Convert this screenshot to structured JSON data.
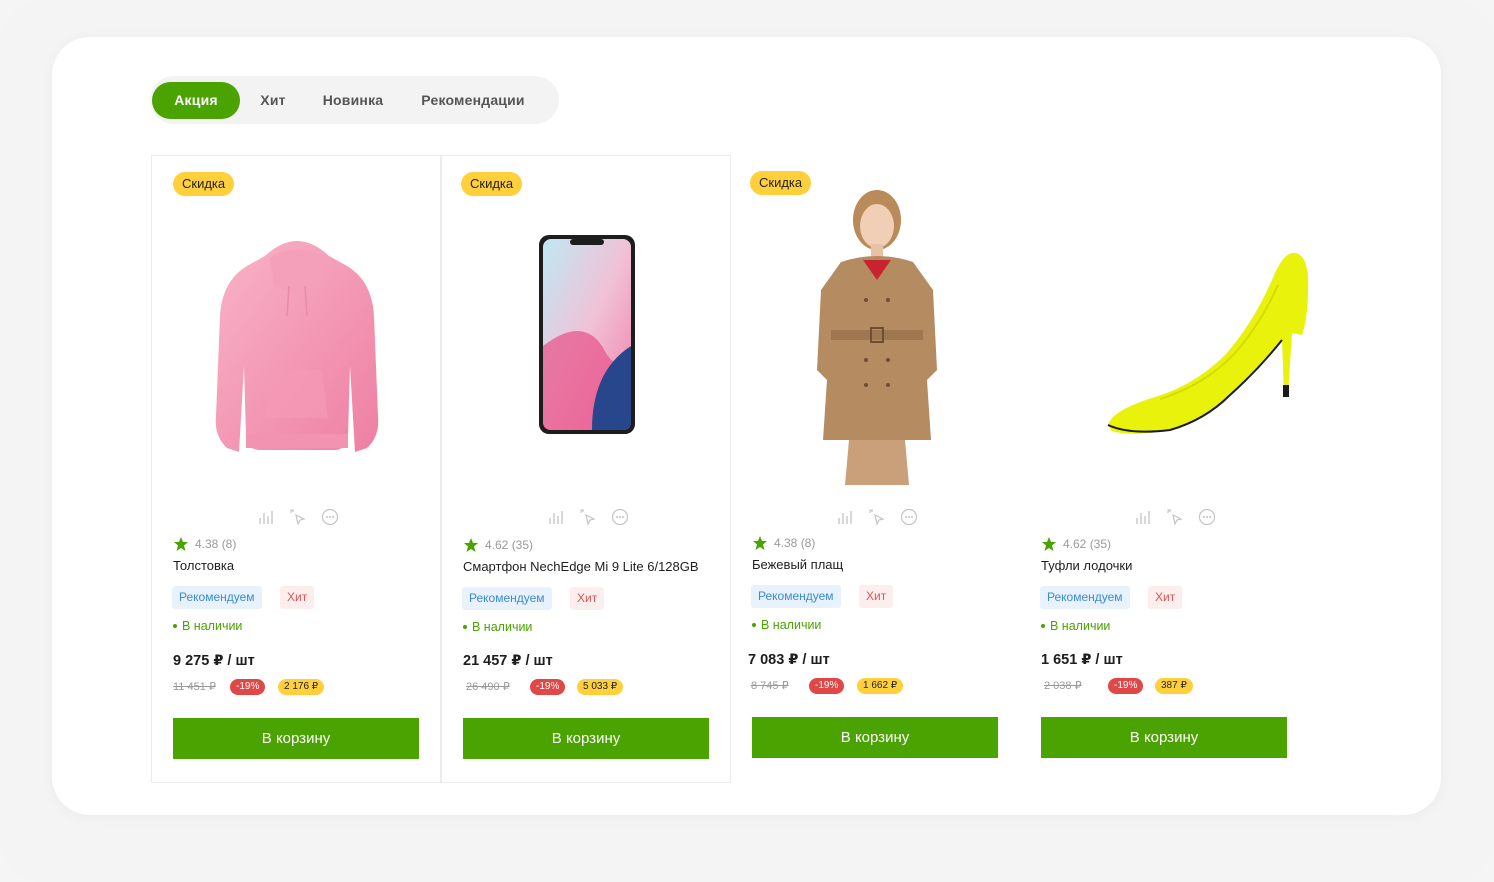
{
  "tabs": [
    {
      "label": "Акция",
      "active": true
    },
    {
      "label": "Хит",
      "active": false
    },
    {
      "label": "Новинка",
      "active": false
    },
    {
      "label": "Рекомендации",
      "active": false
    }
  ],
  "colors": {
    "accent": "#4aa300",
    "badge_yellow": "#ffcf3c",
    "discount_red": "#e04848"
  },
  "products": [
    {
      "sale_badge": "Скидка",
      "image": "pink-hoodie",
      "rating": "4.38 (8)",
      "name": "Толстовка",
      "tag_recommend": "Рекомендуем",
      "tag_hit": "Хит",
      "stock": "В наличии",
      "price": "9 275 ₽ / шт",
      "old_price": "11 451 ₽",
      "discount": "-19%",
      "saving": "2 176 ₽",
      "cart_label": "В корзину"
    },
    {
      "sale_badge": "Скидка",
      "image": "smartphone",
      "rating": "4.62 (35)",
      "name": "Смартфон NechEdge Mi 9 Lite 6/128GB",
      "tag_recommend": "Рекомендуем",
      "tag_hit": "Хит",
      "stock": "В наличии",
      "price": "21 457 ₽ / шт",
      "old_price": "26 490 ₽",
      "discount": "-19%",
      "saving": "5 033 ₽",
      "cart_label": "В корзину"
    },
    {
      "sale_badge": "Скидка",
      "image": "beige-trench-coat",
      "rating": "4.38 (8)",
      "name": "Бежевый плащ",
      "tag_recommend": "Рекомендуем",
      "tag_hit": "Хит",
      "stock": "В наличии",
      "price": "7 083 ₽ / шт",
      "old_price": "8 745 ₽",
      "discount": "-19%",
      "saving": "1 662 ₽",
      "cart_label": "В корзину"
    },
    {
      "image": "yellow-high-heel-shoe",
      "rating": "4.62 (35)",
      "name": "Туфли лодочки",
      "tag_recommend": "Рекомендуем",
      "tag_hit": "Хит",
      "stock": "В наличии",
      "price": "1 651 ₽ / шт",
      "old_price": "2 038 ₽",
      "discount": "-19%",
      "saving": "387 ₽",
      "cart_label": "В корзину"
    }
  ]
}
